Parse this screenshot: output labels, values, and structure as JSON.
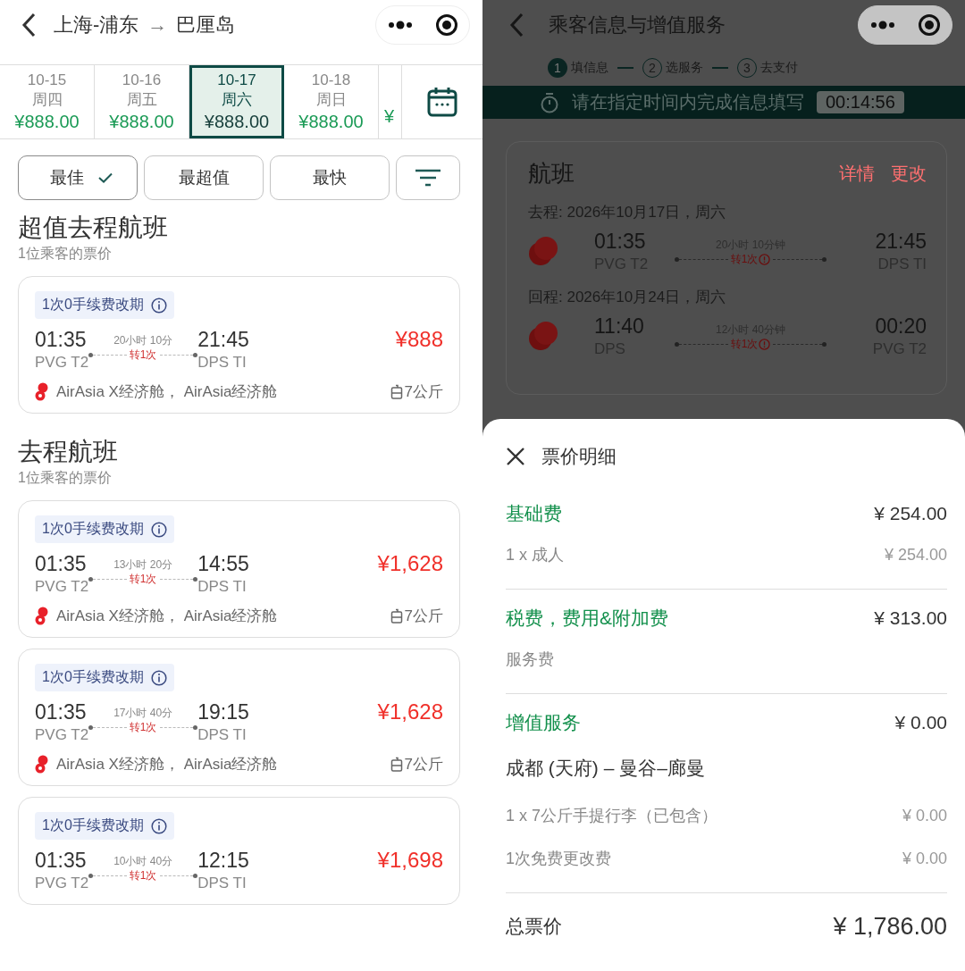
{
  "search_page": {
    "header": {
      "origin": "上海-浦东",
      "arrow": "→",
      "destination": "巴厘岛"
    },
    "date_tabs": [
      {
        "date": "10-15",
        "weekday": "周四",
        "price": "¥888.00",
        "selected": false
      },
      {
        "date": "10-16",
        "weekday": "周五",
        "price": "¥888.00",
        "selected": false
      },
      {
        "date": "10-17",
        "weekday": "周六",
        "price": "¥888.00",
        "selected": true
      },
      {
        "date": "10-18",
        "weekday": "周日",
        "price": "¥888.00",
        "selected": false
      },
      {
        "price": "¥",
        "selected": false
      }
    ],
    "sort_buttons": [
      {
        "label": "最佳",
        "selected": true
      },
      {
        "label": "最超值",
        "selected": false
      },
      {
        "label": "最快",
        "selected": false
      }
    ],
    "sections": [
      {
        "title": "超值去程航班",
        "subtitle": "1位乘客的票价",
        "flights": [
          {
            "badge": "1次0手续费改期",
            "depart_time": "01:35",
            "depart_airport": "PVG T2",
            "duration": "20小时 10分",
            "stops": "转1次",
            "arrive_time": "21:45",
            "arrive_airport": "DPS TI",
            "price": "¥888",
            "airlines": "AirAsia X经济舱， AirAsia经济舱",
            "baggage": "7公斤"
          }
        ]
      },
      {
        "title": "去程航班",
        "subtitle": "1位乘客的票价",
        "flights": [
          {
            "badge": "1次0手续费改期",
            "depart_time": "01:35",
            "depart_airport": "PVG T2",
            "duration": "13小时 20分",
            "stops": "转1次",
            "arrive_time": "14:55",
            "arrive_airport": "DPS TI",
            "price": "¥1,628",
            "airlines": "AirAsia X经济舱， AirAsia经济舱",
            "baggage": "7公斤"
          },
          {
            "badge": "1次0手续费改期",
            "depart_time": "01:35",
            "depart_airport": "PVG T2",
            "duration": "17小时 40分",
            "stops": "转1次",
            "arrive_time": "19:15",
            "arrive_airport": "DPS TI",
            "price": "¥1,628",
            "airlines": "AirAsia X经济舱， AirAsia经济舱",
            "baggage": "7公斤"
          },
          {
            "badge": "1次0手续费改期",
            "depart_time": "01:35",
            "depart_airport": "PVG T2",
            "duration": "10小时 40分",
            "stops": "转1次",
            "arrive_time": "12:15",
            "arrive_airport": "DPS TI",
            "price": "¥1,698"
          }
        ]
      }
    ]
  },
  "booking_page": {
    "header": {
      "title": "乘客信息与增值服务"
    },
    "steps": [
      {
        "number": "1",
        "label": "填信息",
        "selected": true
      },
      {
        "number": "2",
        "label": "选服务",
        "selected": false
      },
      {
        "number": "3",
        "label": "去支付",
        "selected": false
      }
    ],
    "timer": {
      "message": "请在指定时间内完成信息填写",
      "time": "00:14:56"
    },
    "flight_card": {
      "title": "航班",
      "links": [
        "详情",
        "更改"
      ],
      "legs": [
        {
          "label": "去程: 2026年10月17日，周六",
          "depart_time": "01:35",
          "depart_airport": "PVG T2",
          "duration": "20小时 10分钟",
          "stops": "转1次",
          "arrive_time": "21:45",
          "arrive_airport": "DPS TI"
        },
        {
          "label": "回程: 2026年10月24日，周六",
          "depart_time": "11:40",
          "depart_airport": "DPS",
          "duration": "12小时 40分钟",
          "stops": "转1次",
          "arrive_time": "00:20",
          "arrive_airport": "PVG T2"
        }
      ]
    },
    "price_sheet": {
      "title": "票价明细",
      "sections": [
        {
          "title": "基础费",
          "amount": "¥ 254.00",
          "lines": [
            {
              "kind": "line",
              "label": "1 x 成人",
              "amount": "¥ 254.00"
            }
          ]
        },
        {
          "title": "税费，费用&附加费",
          "amount": "¥ 313.00",
          "lines": [
            {
              "kind": "line",
              "label": "服务费"
            }
          ]
        },
        {
          "title": "增值服务",
          "amount": "¥ 0.00",
          "lines": [
            {
              "kind": "subheading",
              "label": "成都 (天府) – 曼谷–廊曼"
            },
            {
              "kind": "line",
              "label": "1 x 7公斤手提行李（已包含）",
              "amount": "¥ 0.00"
            },
            {
              "kind": "line",
              "label": "1次免费更改费",
              "amount": "¥ 0.00"
            }
          ]
        }
      ],
      "total": {
        "label": "总票价",
        "amount": "¥ 1,786.00"
      }
    }
  }
}
